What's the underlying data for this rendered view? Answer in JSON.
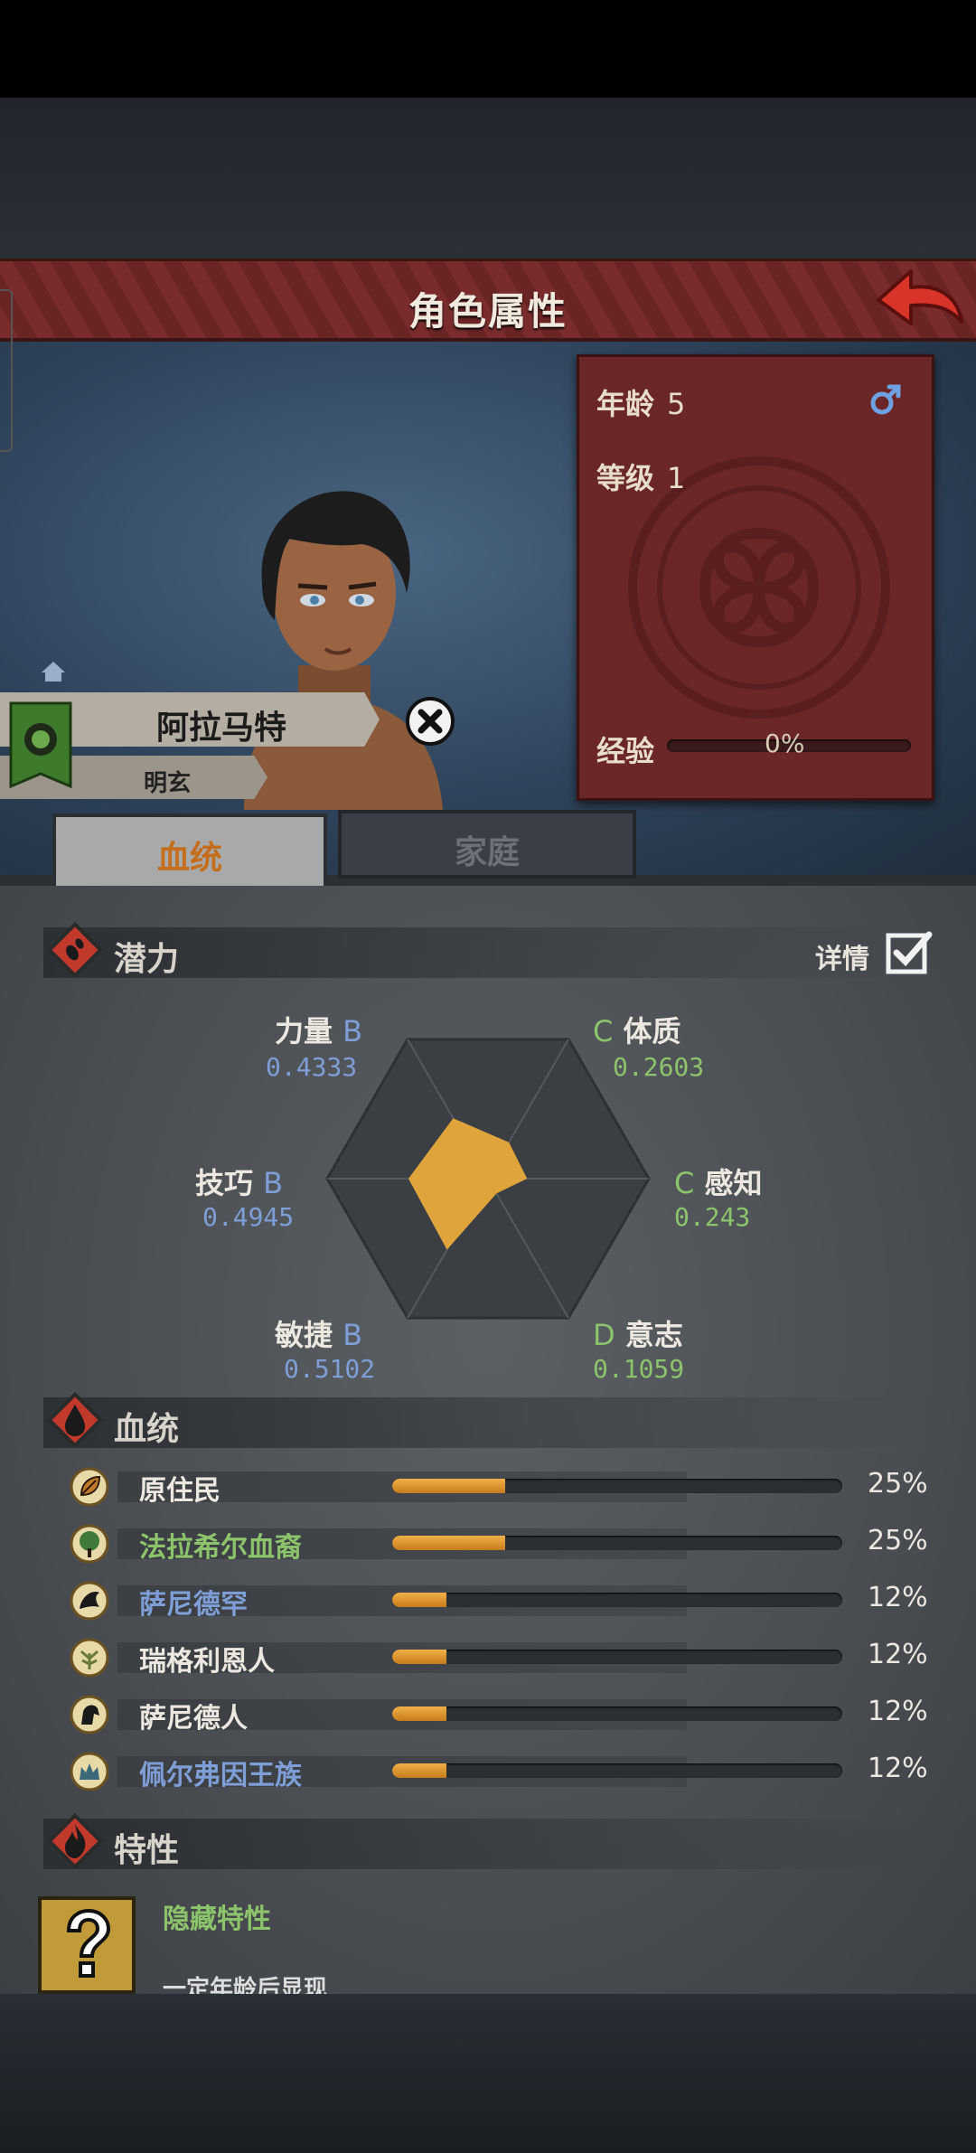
{
  "header": {
    "title": "角色属性"
  },
  "character": {
    "name": "阿拉马特",
    "title": "明玄",
    "age_label": "年龄",
    "age": "5",
    "level_label": "等级",
    "level": "1",
    "exp_label": "经验",
    "exp_percent": "0%",
    "gender_icon": "male-icon"
  },
  "tabs": [
    {
      "label": "血统",
      "active": true
    },
    {
      "label": "家庭",
      "active": false
    }
  ],
  "potential": {
    "section_label": "潜力",
    "detail_label": "详情",
    "detail_checked": true,
    "stats": [
      {
        "name": "力量",
        "grade": "B",
        "value": "0.4333"
      },
      {
        "name": "体质",
        "grade": "C",
        "value": "0.2603"
      },
      {
        "name": "感知",
        "grade": "C",
        "value": "0.243"
      },
      {
        "name": "意志",
        "grade": "D",
        "value": "0.1059"
      },
      {
        "name": "敏捷",
        "grade": "B",
        "value": "0.5102"
      },
      {
        "name": "技巧",
        "grade": "B",
        "value": "0.4945"
      }
    ],
    "fill_color": "#e0a43c"
  },
  "lineage": {
    "section_label": "血统",
    "items": [
      {
        "name": "原住民",
        "percent": "25%",
        "fraction": 0.25,
        "color": "#ece8e0",
        "icon": "leaf-icon"
      },
      {
        "name": "法拉希尔血裔",
        "percent": "25%",
        "fraction": 0.25,
        "color": "#8cc46c",
        "icon": "tree-icon"
      },
      {
        "name": "萨尼德罕",
        "percent": "12%",
        "fraction": 0.12,
        "color": "#7d9ed6",
        "icon": "dragon-icon"
      },
      {
        "name": "瑞格利恩人",
        "percent": "12%",
        "fraction": 0.12,
        "color": "#ece8e0",
        "icon": "plant-icon"
      },
      {
        "name": "萨尼德人",
        "percent": "12%",
        "fraction": 0.12,
        "color": "#ece8e0",
        "icon": "horse-icon"
      },
      {
        "name": "佩尔弗因王族",
        "percent": "12%",
        "fraction": 0.12,
        "color": "#7d9ed6",
        "icon": "crown-icon"
      }
    ]
  },
  "traits": {
    "section_label": "特性",
    "hidden_title": "隐藏特性",
    "hidden_desc": "一定年龄后显现"
  }
}
